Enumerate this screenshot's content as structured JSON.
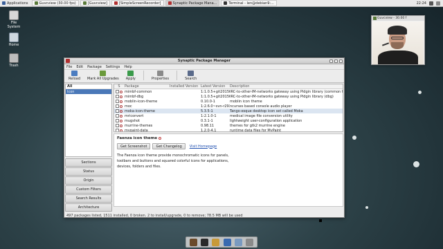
{
  "top_panel": {
    "applications_label": "Applications",
    "tasks": [
      {
        "label": "Guvcview  (30.00 fps)",
        "active": false
      },
      {
        "label": "[Guvcview]",
        "active": false
      },
      {
        "label": "[SimpleScreenRecorder]",
        "active": false
      },
      {
        "label": "Synaptic Package Mana...",
        "active": true
      },
      {
        "label": "Terminal - len@debian9:...",
        "active": false
      }
    ],
    "clock": "22:24"
  },
  "desktop_icons": [
    {
      "label": "File System",
      "icon": "drive-icon",
      "color": "#d7d7d7"
    },
    {
      "label": "Home",
      "icon": "home-folder-icon",
      "color": "#cfd8e0"
    },
    {
      "label": "Trash",
      "icon": "trash-icon",
      "color": "#bdbdbd"
    }
  ],
  "window": {
    "title": "Synaptic Package Manager",
    "menu": [
      "File",
      "Edit",
      "Package",
      "Settings",
      "Help"
    ],
    "toolbar": [
      {
        "label": "Reload",
        "icon": "reload-icon",
        "color": "#4a7cc0"
      },
      {
        "label": "Mark All Upgrades",
        "icon": "upgrade-icon",
        "color": "#6a9a3a"
      },
      {
        "label": "Apply",
        "icon": "apply-icon",
        "color": "#3a9a4a"
      },
      {
        "label": "Properties",
        "icon": "properties-icon",
        "color": "#8a8a8a"
      },
      {
        "label": "Search",
        "icon": "search-icon",
        "color": "#5a6a8a"
      }
    ],
    "filters": {
      "header": "All",
      "items": [
        "Icon"
      ]
    },
    "view_buttons": [
      "Sections",
      "Status",
      "Origin",
      "Custom Filters",
      "Search Results",
      "Architecture"
    ],
    "columns": {
      "s": "S",
      "package": "Package",
      "installed": "Installed Version",
      "latest": "Latest Version",
      "description": "Description"
    },
    "packages": [
      {
        "name": "mimbf-common",
        "installed": "",
        "latest": "1:1.0.5+git201505(",
        "description": "IRC-to-other-IM-networks gateway using Pidgin library (common files)"
      },
      {
        "name": "mimbf-dbg",
        "installed": "",
        "latest": "1:1.0.5+git201505(",
        "description": "IRC-to-other-IM-networks gateway using Pidgin library (dbg)"
      },
      {
        "name": "moblin-icon-theme",
        "installed": "",
        "latest": "0.10.0-1",
        "description": "moblin icon theme"
      },
      {
        "name": "moc",
        "installed": "",
        "latest": "1:2.6.0~svn-r2935-",
        "description": "ncurses based console audio player"
      },
      {
        "name": "moka-icon-theme",
        "installed": "",
        "latest": "5.3.5-1",
        "description": "Tango-esque desktop icon set called Moka"
      },
      {
        "name": "mriconvert",
        "installed": "",
        "latest": "1:2.1.0-1",
        "description": "medical image file conversion utility"
      },
      {
        "name": "mugshot",
        "installed": "",
        "latest": "0.3.1-1",
        "description": "lightweight user-configuration application"
      },
      {
        "name": "murrine-themes",
        "installed": "",
        "latest": "0.98.11",
        "description": "themes for gtk2 murrine engine"
      },
      {
        "name": "mypaint-data",
        "installed": "",
        "latest": "1.2.0-4.1",
        "description": "runtime data files for MyPaint"
      }
    ],
    "selected_package_index": 4,
    "details": {
      "title": "Faenza icon theme",
      "screenshot_button": "Get Screenshot",
      "changelog_button": "Get Changelog",
      "homepage_link": "Visit Homepage",
      "description": "The Faenza icon theme provide monochromatic icons for panels, toolbars and buttons and squared colorful icons for applications, devices, folders and files."
    },
    "status": "497 packages listed, 1511 installed, 0 broken. 2 to install/upgrade, 0 to remove; 78.5 MB will be used"
  },
  "webcam": {
    "title": "Guvcview - 30.00 f"
  },
  "dock": [
    {
      "icon": "show-desktop-icon",
      "color": "#6a4a2a"
    },
    {
      "icon": "terminal-icon",
      "color": "#2a2a2a"
    },
    {
      "icon": "file-manager-icon",
      "color": "#c89a3a"
    },
    {
      "icon": "web-browser-icon",
      "color": "#3a6ab0"
    },
    {
      "icon": "app-finder-icon",
      "color": "#7a9ac0"
    },
    {
      "icon": "folder-icon",
      "color": "#8a8a8a"
    }
  ]
}
